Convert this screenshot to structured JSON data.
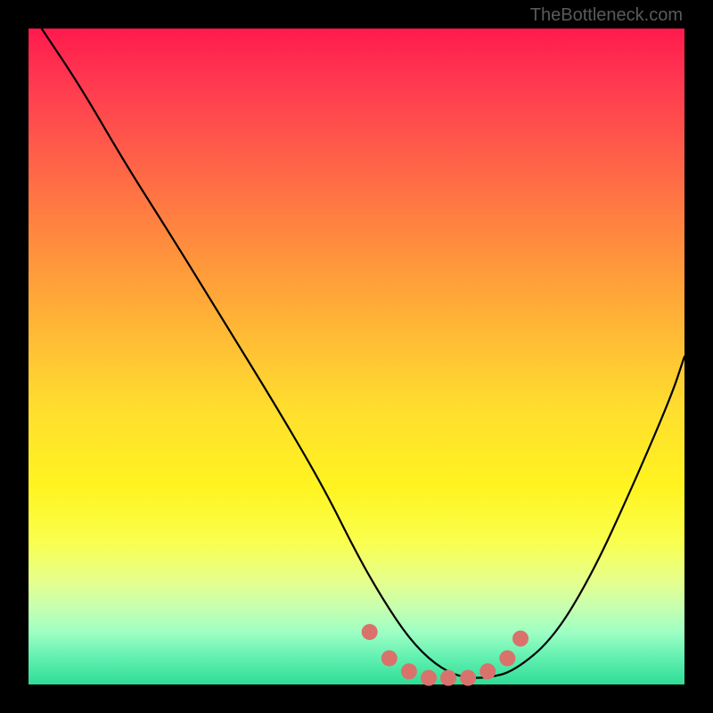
{
  "watermark": "TheBottleneck.com",
  "chart_data": {
    "type": "line",
    "title": "",
    "xlabel": "",
    "ylabel": "",
    "xlim": [
      0,
      100
    ],
    "ylim": [
      0,
      100
    ],
    "grid": false,
    "legend": false,
    "annotations": [],
    "series": [
      {
        "name": "bottleneck-curve",
        "color": "#000000",
        "x": [
          2,
          8,
          15,
          22,
          30,
          38,
          45,
          50,
          54,
          58,
          62,
          66,
          70,
          74,
          80,
          86,
          92,
          98,
          100
        ],
        "y": [
          100,
          91,
          79,
          68,
          55,
          42,
          30,
          20,
          13,
          7,
          3,
          1,
          1,
          2,
          7,
          17,
          30,
          44,
          50
        ]
      },
      {
        "name": "highlight-dots",
        "color": "#d9726b",
        "type": "scatter",
        "x": [
          52,
          55,
          58,
          61,
          64,
          67,
          70,
          73,
          75
        ],
        "y": [
          8,
          4,
          2,
          1,
          1,
          1,
          2,
          4,
          7
        ]
      }
    ],
    "gradient_stops": [
      {
        "pos": 0,
        "color": "#ff1a4d"
      },
      {
        "pos": 8,
        "color": "#ff3850"
      },
      {
        "pos": 18,
        "color": "#ff5a4a"
      },
      {
        "pos": 32,
        "color": "#ff8a3e"
      },
      {
        "pos": 45,
        "color": "#ffb536"
      },
      {
        "pos": 58,
        "color": "#ffde2e"
      },
      {
        "pos": 70,
        "color": "#fff420"
      },
      {
        "pos": 78,
        "color": "#faff4d"
      },
      {
        "pos": 84,
        "color": "#e7ff8a"
      },
      {
        "pos": 88,
        "color": "#c9ffad"
      },
      {
        "pos": 92,
        "color": "#9effc4"
      },
      {
        "pos": 96,
        "color": "#60f0b0"
      },
      {
        "pos": 100,
        "color": "#2fdc96"
      }
    ]
  }
}
